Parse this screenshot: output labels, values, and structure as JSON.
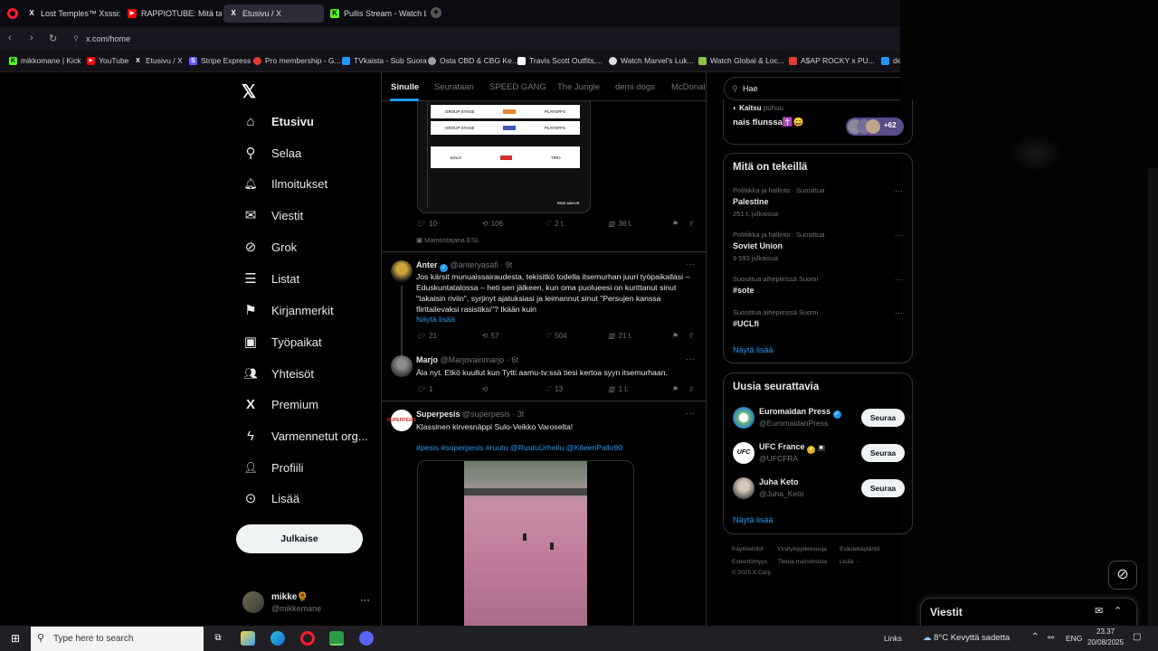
{
  "browser": {
    "tabs": [
      {
        "title": "Lost Temples™ Xsssi: \"Sor",
        "fav": "X",
        "color": "#ffffff"
      },
      {
        "title": "RAPPIOTUBE: Mitä tapaht",
        "fav": "▶",
        "color": "#ff0000"
      },
      {
        "title": "Etusivu / X",
        "fav": "X",
        "color": "#ffffff"
      },
      {
        "title": "Pullis Stream - Watch Live",
        "fav": "K",
        "color": "#53fc18"
      }
    ],
    "url": "x.com/home",
    "bookmarks": [
      {
        "label": "mikkomane | Kick",
        "color": "#53fc18"
      },
      {
        "label": "YouTube",
        "color": "#ff0000"
      },
      {
        "label": "Etusivu / X",
        "color": "#ffffff"
      },
      {
        "label": "Stripe Express",
        "color": "#635bff"
      },
      {
        "label": "Pro membership - G...",
        "color": "#e53935"
      },
      {
        "label": "TVkaista - Sub Suora",
        "color": "#2196f3"
      },
      {
        "label": "Osta CBD & CBG Ke...",
        "color": "#9e9e9e"
      },
      {
        "label": "Travis Scott Outfits,...",
        "color": "#ffffff"
      },
      {
        "label": "Watch Marvel's Luk...",
        "color": "#dddddd"
      },
      {
        "label": "Watch Global & Loc...",
        "color": "#8bc34a"
      },
      {
        "label": "A$AP ROCKY x PU...",
        "color": "#e53935"
      },
      {
        "label": "de",
        "color": "#2196f3"
      }
    ]
  },
  "nav": {
    "items": [
      {
        "label": "Etusivu",
        "icon": "⌂"
      },
      {
        "label": "Selaa",
        "icon": "⚲"
      },
      {
        "label": "Ilmoitukset",
        "icon": "🔔"
      },
      {
        "label": "Viestit",
        "icon": "✉"
      },
      {
        "label": "Grok",
        "icon": "⊘"
      },
      {
        "label": "Listat",
        "icon": "☰"
      },
      {
        "label": "Kirjanmerkit",
        "icon": "⚑"
      },
      {
        "label": "Työpaikat",
        "icon": "▣"
      },
      {
        "label": "Yhteisöt",
        "icon": "👥"
      },
      {
        "label": "Premium",
        "icon": "X"
      },
      {
        "label": "Varmennetut org...",
        "icon": "ϟ"
      },
      {
        "label": "Profiili",
        "icon": "👤"
      },
      {
        "label": "Lisää",
        "icon": "⊙"
      }
    ],
    "post_label": "Julkaise",
    "account": {
      "name": "mikke🌻",
      "handle": "@mikkemane"
    }
  },
  "feed": {
    "tabs": [
      "Sinulle",
      "Seurataan",
      "SPEED GANG",
      "The Jungle",
      "demi dogs",
      "McDonal"
    ],
    "ad": {
      "graphic": {
        "rows": [
          "GROUP STAGE",
          "GROUP STAGE",
          "SOLO"
        ],
        "cols": [
          "PLAYOFFS",
          "PLAYOFFS",
          "TRIO"
        ],
        "tag": "RISE ABOVE"
      },
      "stats": {
        "replies": "10",
        "reposts": "106",
        "likes": "2 t.",
        "views": "36 t."
      },
      "label": "Mainostajana ESL"
    },
    "tweets": [
      {
        "name": "Anter",
        "handle": "@anteryasafi",
        "time": "9t",
        "text": "Jos kärsit munuaissairaudesta, tekisitkö todella itsemurhan juuri työpaikallasi – Eduskuntatalossa – heti sen jälkeen, kun oma puolueesi on kurittanut sinut \"takaisin riviin\", syrjinyt ajatuksiasi ja leimannut sinut \"Persujen kanssa flirttailevaksi rasistiksi\"? Ikään kuin",
        "more": "Näytä lisää",
        "stats": {
          "replies": "21",
          "reposts": "57",
          "likes": "504",
          "views": "21 t."
        }
      },
      {
        "name": "Marjo",
        "handle": "@Marjovainmarjo",
        "time": "6t",
        "text": "Äla nyt. Etkö kuullut kun Tytti aamu-tv:ssä tiesi kertoa syyn itsemurhaan.",
        "stats": {
          "replies": "1",
          "reposts": "",
          "likes": "13",
          "views": "1 t."
        }
      },
      {
        "name": "Superpesis",
        "handle": "@superpesis",
        "time": "3t",
        "text": "Klassinen kirvesnäppi Sulo-Veikko Varoselta!",
        "hashtags": "#pesis #superpesis #ruutu @RuutuUrheilu @KiteenPallo90"
      }
    ]
  },
  "sidebar": {
    "search_placeholder": "Hae",
    "space": {
      "host": "Kaitsu",
      "status": "puhuu",
      "title": "nais flunssa✝️😄",
      "listeners": "+62"
    },
    "trends_title": "Mitä on tekeillä",
    "trends": [
      {
        "meta": "Politiikka ja hallinto · Suosittua",
        "name": "Palestine",
        "count": "251 t. julkaisua"
      },
      {
        "meta": "Politiikka ja hallinto · Suosittua",
        "name": "Soviet Union",
        "count": "9 593 julkaisua"
      },
      {
        "meta": "Suosittua aihepiirissä Suomi",
        "name": "#sote",
        "count": ""
      },
      {
        "meta": "Suosittua aihepiirissä Suomi",
        "name": "#UCLfi",
        "count": ""
      }
    ],
    "trends_more": "Näytä lisää",
    "follow_title": "Uusia seurattavia",
    "follow": [
      {
        "name": "Euromaidan Press",
        "handle": "@EuromaidanPress",
        "btn": "Seuraa"
      },
      {
        "name": "UFC France",
        "handle": "@UFCFRA",
        "btn": "Seuraa"
      },
      {
        "name": "Juha Keto",
        "handle": "@Juha_Keto",
        "btn": "Seuraa"
      }
    ],
    "follow_more": "Näytä lisää",
    "footer": [
      "Käyttöehdot",
      "Yksityisyydensuoja",
      "Evästekäytäntö",
      "Esteettömyys",
      "Tietoa mainoksista",
      "Lisää ···",
      "© 2025 X Corp."
    ]
  },
  "messages": {
    "title": "Viestit"
  },
  "taskbar": {
    "search_placeholder": "Type here to search",
    "links": "Links",
    "weather": "8°C  Kevyttä sadetta",
    "lang": "ENG",
    "time": "23.37",
    "date": "20/08/2025"
  }
}
